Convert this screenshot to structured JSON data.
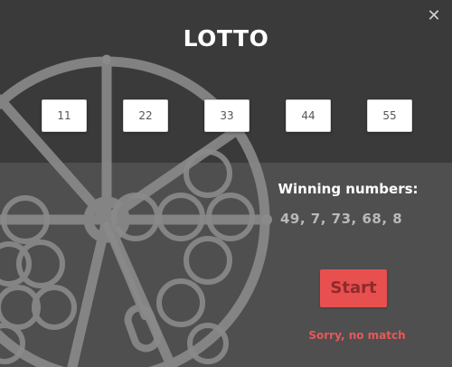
{
  "window": {
    "close_label": "✕"
  },
  "title": "LOTTO",
  "picks": [
    "11",
    "22",
    "33",
    "44",
    "55"
  ],
  "winning": {
    "label": "Winning numbers:",
    "numbers": "49,  7,  73,  68,  8"
  },
  "start_button": {
    "label": "Start"
  },
  "status": "Sorry, no match",
  "colors": {
    "top_band": "#3a3a3a",
    "bottom_band": "#4f4f4f",
    "accent": "#e84f4f",
    "status": "#e85858",
    "wheel": "#8a8a8a"
  },
  "icons": {
    "close": "close-icon",
    "wheel": "lottery-wheel-icon"
  }
}
